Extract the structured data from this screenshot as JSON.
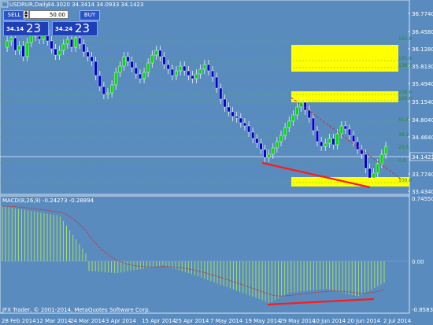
{
  "chart": {
    "title": "USDRUR,Daily",
    "ohlc": "34.3020 34.3414 34.0933 34.1423",
    "current_price": "34.1423",
    "price_labels": [
      "36.7740",
      "36.4580",
      "36.1280",
      "35.8130",
      "35.4940",
      "35.1540",
      "34.8040",
      "34.4640",
      "34.1423",
      "33.7740",
      "33.4340"
    ],
    "date_labels": [
      "28 Feb 2014",
      "12 Mar 2014",
      "24 Mar 2014",
      "3 Apr 2014",
      "15 Apr 2014",
      "25 Apr 2014",
      "7 May 2014",
      "19 May 2014",
      "29 May 2014",
      "10 Jun 2014",
      "20 Jun 2014",
      "2 Jul 2014"
    ],
    "fib_labels": [
      "161.8",
      "161.8",
      "138.2",
      "100.0",
      "100.0",
      "61.8",
      "38.2",
      "23.6",
      "0.0",
      "100.0"
    ],
    "macd_title": "MACD(8,26,9) -0.24273 -0.28894",
    "macd_labels": [
      "0.745508",
      "0.00",
      "-0.858306"
    ],
    "copyright": "JFX Trader, © 2001-2014, MetaQuotes Software Corp."
  },
  "trade": {
    "sell_label": "SELL",
    "buy_label": "BUY",
    "lot": "50.00",
    "bid_small": "34.14",
    "bid_big": "23",
    "ask_small": "34.24",
    "ask_big": "23"
  },
  "colors": {
    "background": "#5a8bbf",
    "bull": "#00e000",
    "bear": "#0000cc",
    "fib_zone": "#ffff00",
    "trendline": "#ff1a1a",
    "macd_hist": "#a8e060",
    "signal": "#c03030"
  }
}
